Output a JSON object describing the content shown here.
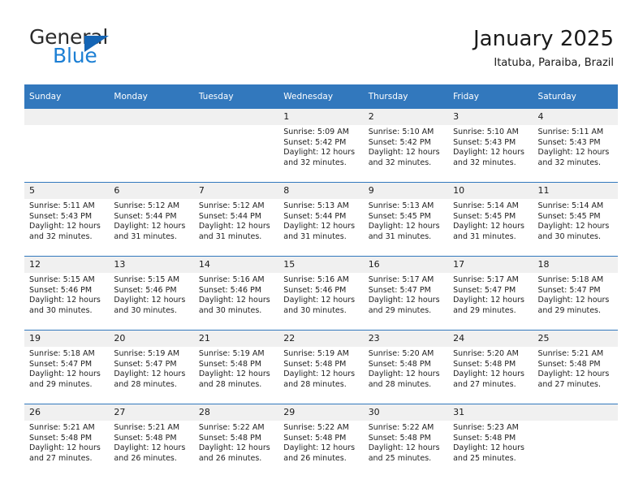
{
  "brand": {
    "name_part1": "General",
    "name_part2": "Blue",
    "triangle_color": "#1565b5",
    "blue_color": "#1c7fd4"
  },
  "header": {
    "title": "January 2025",
    "location": "Itatuba, Paraiba, Brazil"
  },
  "theme": {
    "header_bg": "#3278bd",
    "daynum_bg": "#f0f0f0",
    "grid_line": "#3278bd"
  },
  "weekday_headers": [
    "Sunday",
    "Monday",
    "Tuesday",
    "Wednesday",
    "Thursday",
    "Friday",
    "Saturday"
  ],
  "labels": {
    "sunrise_prefix": "Sunrise:",
    "sunset_prefix": "Sunset:",
    "daylight_prefix": "Daylight:"
  },
  "weeks": [
    [
      {
        "day": "",
        "sunrise": "",
        "sunset": "",
        "daylight_line1": "",
        "daylight_line2": "",
        "blank": true
      },
      {
        "day": "",
        "sunrise": "",
        "sunset": "",
        "daylight_line1": "",
        "daylight_line2": "",
        "blank": true
      },
      {
        "day": "",
        "sunrise": "",
        "sunset": "",
        "daylight_line1": "",
        "daylight_line2": "",
        "blank": true
      },
      {
        "day": "1",
        "sunrise": "Sunrise: 5:09 AM",
        "sunset": "Sunset: 5:42 PM",
        "daylight_line1": "Daylight: 12 hours",
        "daylight_line2": "and 32 minutes.",
        "blank": false
      },
      {
        "day": "2",
        "sunrise": "Sunrise: 5:10 AM",
        "sunset": "Sunset: 5:42 PM",
        "daylight_line1": "Daylight: 12 hours",
        "daylight_line2": "and 32 minutes.",
        "blank": false
      },
      {
        "day": "3",
        "sunrise": "Sunrise: 5:10 AM",
        "sunset": "Sunset: 5:43 PM",
        "daylight_line1": "Daylight: 12 hours",
        "daylight_line2": "and 32 minutes.",
        "blank": false
      },
      {
        "day": "4",
        "sunrise": "Sunrise: 5:11 AM",
        "sunset": "Sunset: 5:43 PM",
        "daylight_line1": "Daylight: 12 hours",
        "daylight_line2": "and 32 minutes.",
        "blank": false
      }
    ],
    [
      {
        "day": "5",
        "sunrise": "Sunrise: 5:11 AM",
        "sunset": "Sunset: 5:43 PM",
        "daylight_line1": "Daylight: 12 hours",
        "daylight_line2": "and 32 minutes.",
        "blank": false
      },
      {
        "day": "6",
        "sunrise": "Sunrise: 5:12 AM",
        "sunset": "Sunset: 5:44 PM",
        "daylight_line1": "Daylight: 12 hours",
        "daylight_line2": "and 31 minutes.",
        "blank": false
      },
      {
        "day": "7",
        "sunrise": "Sunrise: 5:12 AM",
        "sunset": "Sunset: 5:44 PM",
        "daylight_line1": "Daylight: 12 hours",
        "daylight_line2": "and 31 minutes.",
        "blank": false
      },
      {
        "day": "8",
        "sunrise": "Sunrise: 5:13 AM",
        "sunset": "Sunset: 5:44 PM",
        "daylight_line1": "Daylight: 12 hours",
        "daylight_line2": "and 31 minutes.",
        "blank": false
      },
      {
        "day": "9",
        "sunrise": "Sunrise: 5:13 AM",
        "sunset": "Sunset: 5:45 PM",
        "daylight_line1": "Daylight: 12 hours",
        "daylight_line2": "and 31 minutes.",
        "blank": false
      },
      {
        "day": "10",
        "sunrise": "Sunrise: 5:14 AM",
        "sunset": "Sunset: 5:45 PM",
        "daylight_line1": "Daylight: 12 hours",
        "daylight_line2": "and 31 minutes.",
        "blank": false
      },
      {
        "day": "11",
        "sunrise": "Sunrise: 5:14 AM",
        "sunset": "Sunset: 5:45 PM",
        "daylight_line1": "Daylight: 12 hours",
        "daylight_line2": "and 30 minutes.",
        "blank": false
      }
    ],
    [
      {
        "day": "12",
        "sunrise": "Sunrise: 5:15 AM",
        "sunset": "Sunset: 5:46 PM",
        "daylight_line1": "Daylight: 12 hours",
        "daylight_line2": "and 30 minutes.",
        "blank": false
      },
      {
        "day": "13",
        "sunrise": "Sunrise: 5:15 AM",
        "sunset": "Sunset: 5:46 PM",
        "daylight_line1": "Daylight: 12 hours",
        "daylight_line2": "and 30 minutes.",
        "blank": false
      },
      {
        "day": "14",
        "sunrise": "Sunrise: 5:16 AM",
        "sunset": "Sunset: 5:46 PM",
        "daylight_line1": "Daylight: 12 hours",
        "daylight_line2": "and 30 minutes.",
        "blank": false
      },
      {
        "day": "15",
        "sunrise": "Sunrise: 5:16 AM",
        "sunset": "Sunset: 5:46 PM",
        "daylight_line1": "Daylight: 12 hours",
        "daylight_line2": "and 30 minutes.",
        "blank": false
      },
      {
        "day": "16",
        "sunrise": "Sunrise: 5:17 AM",
        "sunset": "Sunset: 5:47 PM",
        "daylight_line1": "Daylight: 12 hours",
        "daylight_line2": "and 29 minutes.",
        "blank": false
      },
      {
        "day": "17",
        "sunrise": "Sunrise: 5:17 AM",
        "sunset": "Sunset: 5:47 PM",
        "daylight_line1": "Daylight: 12 hours",
        "daylight_line2": "and 29 minutes.",
        "blank": false
      },
      {
        "day": "18",
        "sunrise": "Sunrise: 5:18 AM",
        "sunset": "Sunset: 5:47 PM",
        "daylight_line1": "Daylight: 12 hours",
        "daylight_line2": "and 29 minutes.",
        "blank": false
      }
    ],
    [
      {
        "day": "19",
        "sunrise": "Sunrise: 5:18 AM",
        "sunset": "Sunset: 5:47 PM",
        "daylight_line1": "Daylight: 12 hours",
        "daylight_line2": "and 29 minutes.",
        "blank": false
      },
      {
        "day": "20",
        "sunrise": "Sunrise: 5:19 AM",
        "sunset": "Sunset: 5:47 PM",
        "daylight_line1": "Daylight: 12 hours",
        "daylight_line2": "and 28 minutes.",
        "blank": false
      },
      {
        "day": "21",
        "sunrise": "Sunrise: 5:19 AM",
        "sunset": "Sunset: 5:48 PM",
        "daylight_line1": "Daylight: 12 hours",
        "daylight_line2": "and 28 minutes.",
        "blank": false
      },
      {
        "day": "22",
        "sunrise": "Sunrise: 5:19 AM",
        "sunset": "Sunset: 5:48 PM",
        "daylight_line1": "Daylight: 12 hours",
        "daylight_line2": "and 28 minutes.",
        "blank": false
      },
      {
        "day": "23",
        "sunrise": "Sunrise: 5:20 AM",
        "sunset": "Sunset: 5:48 PM",
        "daylight_line1": "Daylight: 12 hours",
        "daylight_line2": "and 28 minutes.",
        "blank": false
      },
      {
        "day": "24",
        "sunrise": "Sunrise: 5:20 AM",
        "sunset": "Sunset: 5:48 PM",
        "daylight_line1": "Daylight: 12 hours",
        "daylight_line2": "and 27 minutes.",
        "blank": false
      },
      {
        "day": "25",
        "sunrise": "Sunrise: 5:21 AM",
        "sunset": "Sunset: 5:48 PM",
        "daylight_line1": "Daylight: 12 hours",
        "daylight_line2": "and 27 minutes.",
        "blank": false
      }
    ],
    [
      {
        "day": "26",
        "sunrise": "Sunrise: 5:21 AM",
        "sunset": "Sunset: 5:48 PM",
        "daylight_line1": "Daylight: 12 hours",
        "daylight_line2": "and 27 minutes.",
        "blank": false
      },
      {
        "day": "27",
        "sunrise": "Sunrise: 5:21 AM",
        "sunset": "Sunset: 5:48 PM",
        "daylight_line1": "Daylight: 12 hours",
        "daylight_line2": "and 26 minutes.",
        "blank": false
      },
      {
        "day": "28",
        "sunrise": "Sunrise: 5:22 AM",
        "sunset": "Sunset: 5:48 PM",
        "daylight_line1": "Daylight: 12 hours",
        "daylight_line2": "and 26 minutes.",
        "blank": false
      },
      {
        "day": "29",
        "sunrise": "Sunrise: 5:22 AM",
        "sunset": "Sunset: 5:48 PM",
        "daylight_line1": "Daylight: 12 hours",
        "daylight_line2": "and 26 minutes.",
        "blank": false
      },
      {
        "day": "30",
        "sunrise": "Sunrise: 5:22 AM",
        "sunset": "Sunset: 5:48 PM",
        "daylight_line1": "Daylight: 12 hours",
        "daylight_line2": "and 25 minutes.",
        "blank": false
      },
      {
        "day": "31",
        "sunrise": "Sunrise: 5:23 AM",
        "sunset": "Sunset: 5:48 PM",
        "daylight_line1": "Daylight: 12 hours",
        "daylight_line2": "and 25 minutes.",
        "blank": false
      },
      {
        "day": "",
        "sunrise": "",
        "sunset": "",
        "daylight_line1": "",
        "daylight_line2": "",
        "blank": true
      }
    ]
  ]
}
